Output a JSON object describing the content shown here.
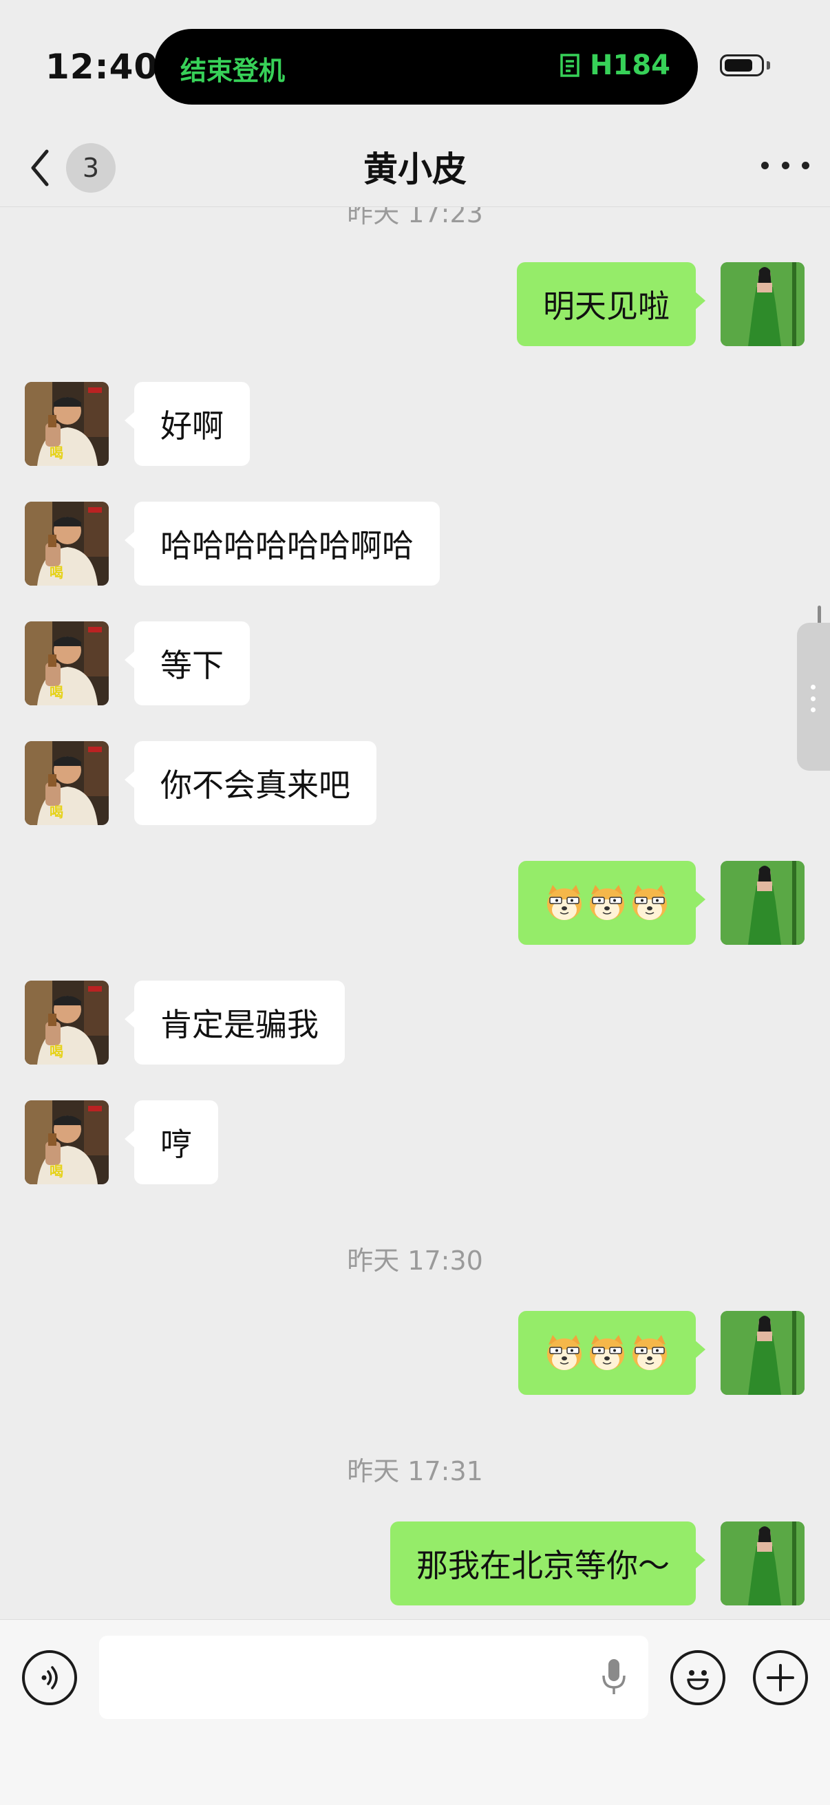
{
  "status_bar": {
    "time": "12:40",
    "activity_left": "结束登机",
    "activity_right": "H184"
  },
  "nav": {
    "unread_count": "3",
    "title": "黄小皮"
  },
  "messages": [
    {
      "type": "timestamp",
      "text": "昨天 17:23"
    },
    {
      "type": "out",
      "text": "明天见啦"
    },
    {
      "type": "in",
      "text": "好啊"
    },
    {
      "type": "in",
      "text": "哈哈哈哈哈哈啊哈"
    },
    {
      "type": "in",
      "text": "等下"
    },
    {
      "type": "in",
      "text": "你不会真来吧"
    },
    {
      "type": "out",
      "sticker": "doge-emoji x3"
    },
    {
      "type": "in",
      "text": "肯定是骗我"
    },
    {
      "type": "in",
      "text": "哼"
    },
    {
      "type": "timestamp",
      "text": "昨天 17:30"
    },
    {
      "type": "out",
      "sticker": "doge-emoji x3"
    },
    {
      "type": "timestamp",
      "text": "昨天 17:31"
    },
    {
      "type": "out",
      "text": "那我在北京等你～"
    }
  ],
  "input_bar": {
    "placeholder": ""
  },
  "colors": {
    "background": "#ededed",
    "outgoing_bubble": "#95ec69",
    "incoming_bubble": "#ffffff",
    "island_text": "#37d158"
  }
}
